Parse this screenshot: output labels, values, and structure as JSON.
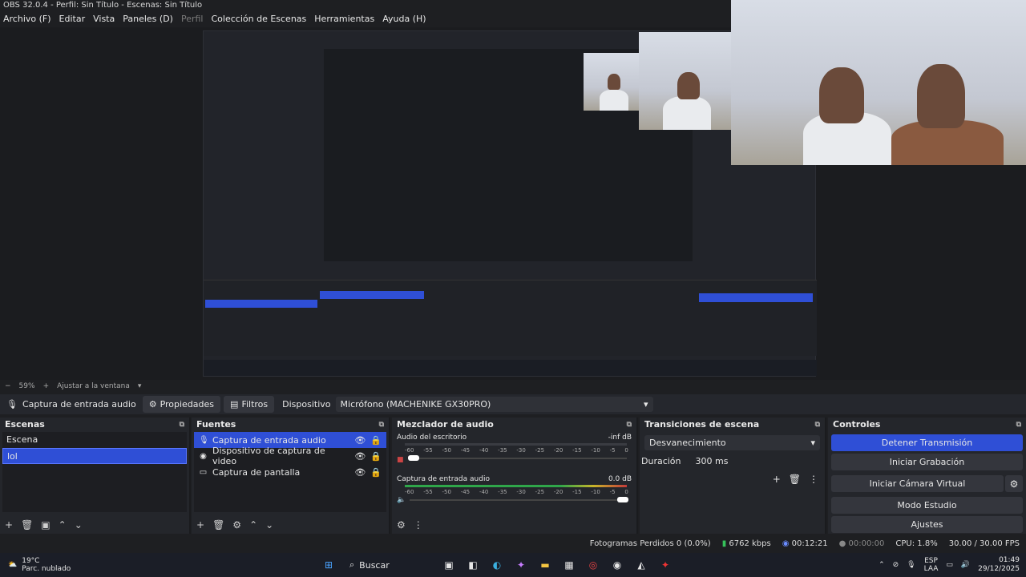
{
  "window": {
    "title": "OBS 32.0.4 - Perfil: Sin Título - Escenas: Sin Título"
  },
  "menu": [
    "Archivo (F)",
    "Editar",
    "Vista",
    "Paneles (D)",
    "Perfil",
    "Colección de Escenas",
    "Herramientas",
    "Ayuda (H)"
  ],
  "zoom": {
    "minus": "−",
    "value": "59%",
    "plus": "+",
    "fit": "Ajustar a la ventana"
  },
  "context": {
    "source": "Captura de entrada audio",
    "properties": "Propiedades",
    "filters": "Filtros",
    "device_label": "Dispositivo",
    "device_value": "Micrófono (MACHENIKE GX30PRO)"
  },
  "scenes": {
    "title": "Escenas",
    "items": [
      "Escena",
      "lol"
    ],
    "selected": 1
  },
  "sources": {
    "title": "Fuentes",
    "items": [
      "Captura de entrada audio",
      "Dispositivo de captura de video",
      "Captura de pantalla"
    ]
  },
  "mixer": {
    "title": "Mezclador de audio",
    "channels": [
      {
        "name": "Audio del escritorio",
        "level": "-inf dB",
        "volume": 0.02
      },
      {
        "name": "Captura de entrada audio",
        "level": "0.0 dB",
        "volume": 0.98
      }
    ],
    "ticks": [
      "-60",
      "-55",
      "-50",
      "-45",
      "-40",
      "-35",
      "-30",
      "-25",
      "-20",
      "-15",
      "-10",
      "-5",
      "0"
    ]
  },
  "transitions": {
    "title": "Transiciones de escena",
    "type": "Desvanecimiento",
    "duration_label": "Duración",
    "duration_value": "300 ms"
  },
  "controls": {
    "title": "Controles",
    "stop_stream": "Detener Transmisión",
    "start_recording": "Iniciar Grabación",
    "virtual_cam": "Iniciar Cámara Virtual",
    "studio_mode": "Modo Estudio",
    "settings": "Ajustes"
  },
  "status": {
    "dropped": "Fotogramas Perdidos 0 (0.0%)",
    "kbps": "6762 kbps",
    "stream_time": "00:12:21",
    "rec_time": "00:00:00",
    "cpu": "CPU: 1.8%",
    "fps": "30.00 / 30.00 FPS"
  },
  "taskbar": {
    "temp": "19°C",
    "weather": "Parc. nublado",
    "search": "Buscar",
    "lang1": "ESP",
    "lang2": "LAA",
    "time": "01:49",
    "date": "29/12/2025"
  },
  "colors": {
    "accent": "#2f4fd6",
    "bg": "#1e1f22",
    "panel": "#24262b"
  }
}
